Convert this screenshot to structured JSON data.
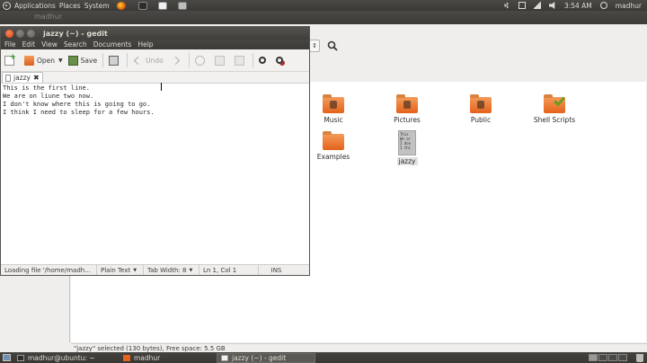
{
  "top_panel": {
    "menus": [
      "Applications",
      "Places",
      "System"
    ],
    "clock": "3:54 AM",
    "user": "madhur"
  },
  "nautilus": {
    "title": "madhur",
    "path_dropdown": "⇕",
    "status": "\"jazzy\" selected (130 bytes), Free space: 5.5 GB",
    "items": [
      {
        "label": "Music"
      },
      {
        "label": "Pictures"
      },
      {
        "label": "Public"
      },
      {
        "label": "Shell Scripts"
      },
      {
        "label": "Examples"
      },
      {
        "label": "jazzy",
        "preview": [
          "This",
          "We ar",
          "I don",
          "I thi"
        ]
      }
    ]
  },
  "gedit": {
    "title": "jazzy (~) - gedit",
    "menus": [
      "File",
      "Edit",
      "View",
      "Search",
      "Documents",
      "Help"
    ],
    "toolbar": {
      "open_label": "Open",
      "save_label": "Save",
      "undo_label": "Undo"
    },
    "tab_label": "jazzy",
    "lines": [
      "This is the first line.",
      "We are on liune two now.",
      "I don't know where this is going to go.",
      "I think I need to sleep for a few hours."
    ],
    "status": {
      "loading": "Loading file '/home/madh...",
      "language": "Plain Text",
      "tab_width": "Tab Width: 8",
      "position": "Ln 1, Col 1",
      "mode": "INS"
    }
  },
  "bottom_panel": {
    "tasks": [
      "madhur@ubuntu: ~",
      "madhur",
      "jazzy (~) - gedit"
    ]
  }
}
